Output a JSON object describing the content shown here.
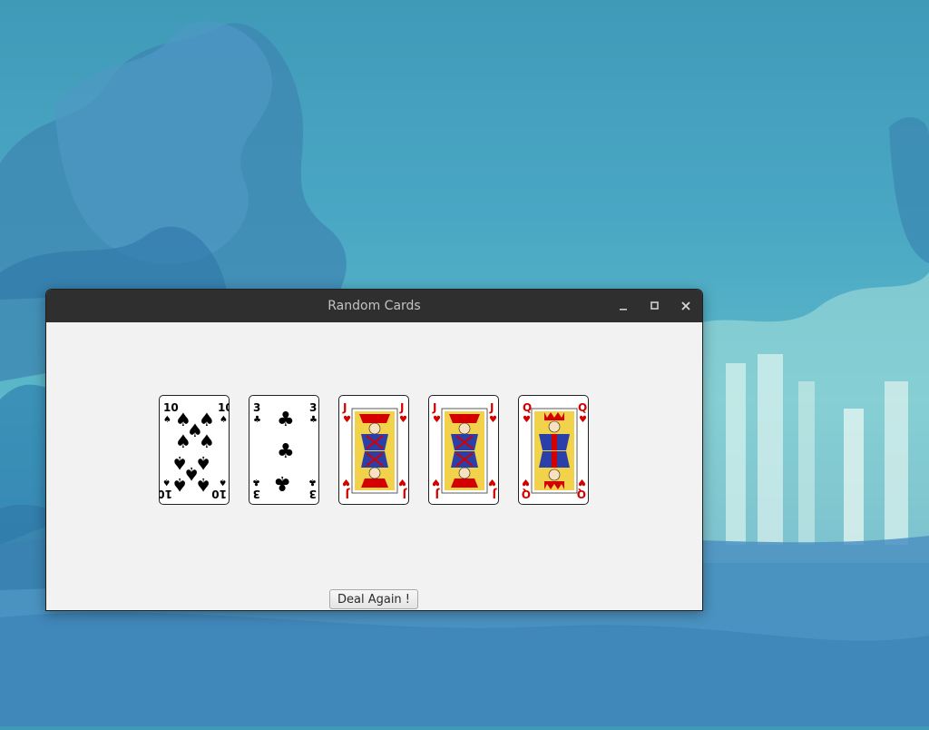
{
  "window": {
    "title": "Random Cards",
    "controls": {
      "minimize": "minimize-icon",
      "maximize": "maximize-icon",
      "close": "close-icon"
    }
  },
  "cards": [
    {
      "rank": "10",
      "suit": "spades",
      "suit_glyph": "♠",
      "color": "#000000"
    },
    {
      "rank": "3",
      "suit": "clubs",
      "suit_glyph": "♣",
      "color": "#000000"
    },
    {
      "rank": "J",
      "suit": "hearts",
      "suit_glyph": "♥",
      "color": "#d40000"
    },
    {
      "rank": "J",
      "suit": "hearts",
      "suit_glyph": "♥",
      "color": "#d40000"
    },
    {
      "rank": "Q",
      "suit": "hearts",
      "suit_glyph": "♥",
      "color": "#d40000"
    }
  ],
  "actions": {
    "deal_again_label": "Deal Again !"
  },
  "colors": {
    "titlebar": "#2f2f2f",
    "window_bg": "#f2f2f2",
    "hearts": "#d40000"
  }
}
